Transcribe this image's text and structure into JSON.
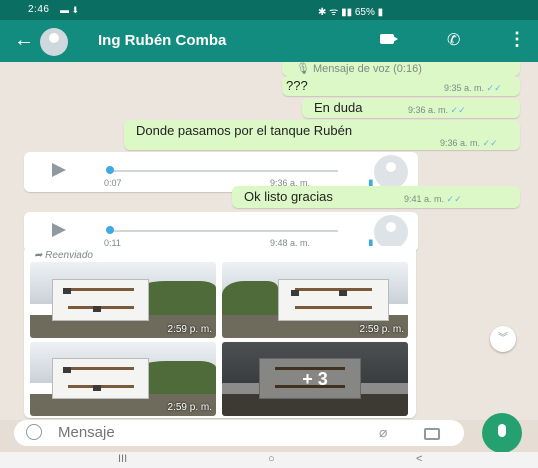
{
  "status": {
    "time": "2:46",
    "battery": "65%"
  },
  "contact": {
    "name": "Ing Rubén Comba"
  },
  "messages": {
    "voice_note_label": "🎙 Mensaje de voz (0:16)",
    "m1": {
      "text": "???",
      "time": "9:35 a. m."
    },
    "m2": {
      "text": "En duda",
      "time": "9:36 a. m."
    },
    "m3": {
      "text": "Donde pasamos por el tanque Rubén",
      "time": "9:36 a. m."
    },
    "audio1": {
      "duration": "0:07",
      "time": "9:36 a. m."
    },
    "m4": {
      "text": "Ok listo gracias",
      "time": "9:41 a. m."
    },
    "audio2": {
      "duration": "0:11",
      "time": "9:48 a. m."
    },
    "forwarded_label": "Reenviado",
    "photos": {
      "t1": "2:59 p. m.",
      "t2": "2:59 p. m.",
      "t3": "2:59 p. m.",
      "more": "+ 3"
    }
  },
  "input": {
    "placeholder": "Mensaje"
  },
  "nav": {
    "recents": "III",
    "home": "○",
    "back": "<"
  }
}
